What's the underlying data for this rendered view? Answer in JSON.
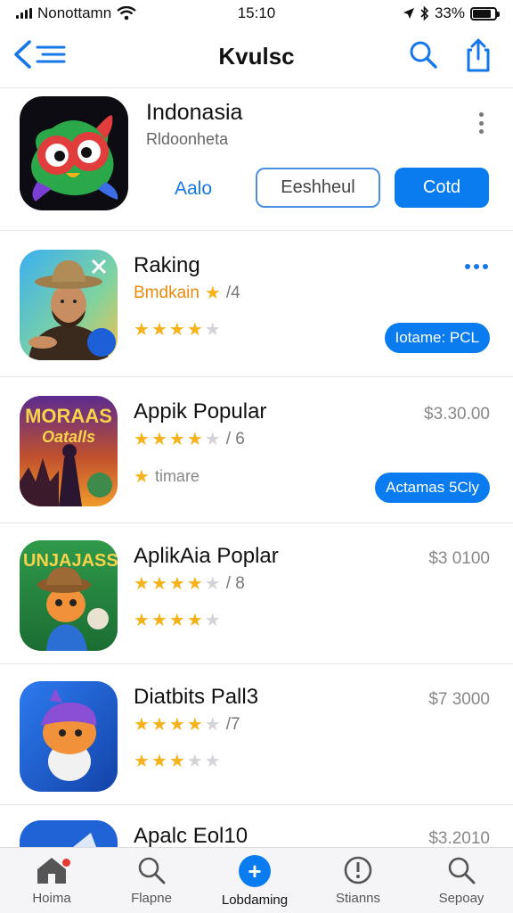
{
  "status_bar": {
    "carrier": "Nonottamn",
    "time": "15:10",
    "battery": "33%",
    "battery_level": 0.85
  },
  "nav": {
    "title": "Kvulsc"
  },
  "header": {
    "title": "Indonasia",
    "subtitle": "Rldoonheta",
    "link_label": "Aalo",
    "outline_button": "Eeshheul",
    "solid_button": "Cotd"
  },
  "apps": [
    {
      "name": "Raking",
      "subtitle": "Bmdkain",
      "rating_note": "/4",
      "rating": 3.5,
      "stars_filled": 3,
      "stars_half": 1,
      "action": "Iotame: PCL",
      "price": ""
    },
    {
      "name": "Appik Popular",
      "subtitle": "",
      "rating_note": "/ 6",
      "rating": 4,
      "stars_filled": 4,
      "stars_half": 0,
      "price": "$3.30.00",
      "line3": "timare",
      "action": "Actamas 5Cly"
    },
    {
      "name": "AplikAia Poplar",
      "subtitle": "",
      "rating_note": "/ 8",
      "rating": 4,
      "stars_filled": 4,
      "stars_half": 0,
      "price": "$3 0100",
      "second_rating": 4
    },
    {
      "name": "Diatbits Pall3",
      "subtitle": "",
      "rating_note": "/7",
      "rating": 3.5,
      "stars_filled": 3,
      "stars_half": 1,
      "price": "$7 3000",
      "second_rating": 2.5
    },
    {
      "name": "Apalc Eol10",
      "price": "$3.2010"
    }
  ],
  "icon_texts": {
    "app2_banner_top": "MORAAS",
    "app2_banner_bottom": "Oatalls",
    "app3_banner": "UNJAJASS"
  },
  "tabs": [
    {
      "label": "Hoima",
      "icon": "home-icon"
    },
    {
      "label": "Flapne",
      "icon": "search-icon"
    },
    {
      "label": "Lobdaming",
      "icon": "plus-circle-icon"
    },
    {
      "label": "Stianns",
      "icon": "alert-icon"
    },
    {
      "label": "Sepoay",
      "icon": "search-icon"
    }
  ],
  "colors": {
    "accent": "#0a7cf0",
    "star": "#f5b21b",
    "badge": "#e53935"
  }
}
